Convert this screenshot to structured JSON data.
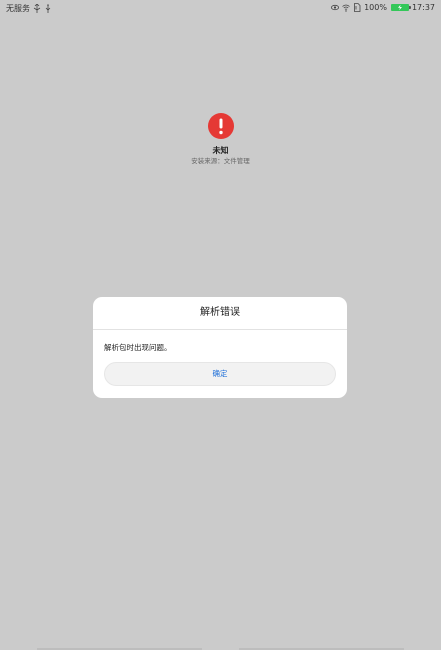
{
  "status_bar": {
    "carrier": "无服务",
    "icons_left": [
      "usb-icon",
      "usb-debug-icon"
    ],
    "icons_right": [
      "eye-comfort-icon",
      "wifi-icon",
      "sim-icon"
    ],
    "battery_percent": "100%",
    "battery_level": 1.0,
    "battery_color": "#34c759",
    "time": "17:37"
  },
  "app": {
    "icon": "error-exclamation-icon",
    "icon_color": "#e53935",
    "name": "未知",
    "install_source": "安装来源：文件管理"
  },
  "dialog": {
    "title": "解析错误",
    "message": "解析包时出现问题。",
    "confirm_label": "确定",
    "confirm_color": "#1e6fd9"
  }
}
